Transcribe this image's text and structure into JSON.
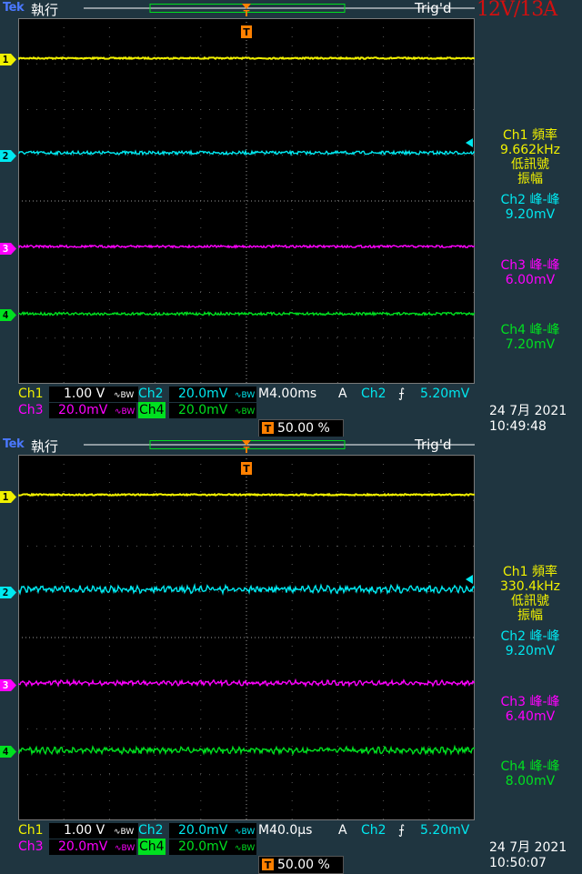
{
  "overlay_title": "12V/13A",
  "panels": [
    {
      "brand": "Tek",
      "run_state": "執行",
      "trigger_status": "Trig'd",
      "channel_markers": [
        "1",
        "2",
        "3",
        "4"
      ],
      "measurements": [
        {
          "line1": "Ch1 頻率",
          "line2": "9.662kHz",
          "line3": "低訊號",
          "line4": "振幅"
        },
        {
          "line1": "Ch2 峰-峰",
          "line2": "9.20mV"
        },
        {
          "line1": "Ch3 峰-峰",
          "line2": "6.00mV"
        },
        {
          "line1": "Ch4 峰-峰",
          "line2": "7.20mV"
        }
      ],
      "settings": {
        "ch1_label": "Ch1",
        "ch1_scale": "1.00 V",
        "ch2_label": "Ch2",
        "ch2_scale": "20.0mV",
        "ch3_label": "Ch3",
        "ch3_scale": "20.0mV",
        "ch4_label": "Ch4",
        "ch4_scale": "20.0mV",
        "bw_symbol": "∿BW",
        "timebase": "M4.00ms",
        "trigger_mode": "A",
        "trigger_source": "Ch2",
        "trigger_slope": "⨍",
        "trigger_level": "5.20mV",
        "trigger_position": "50.00 %"
      },
      "date": "24 7月  2021",
      "time": "10:49:48",
      "noise_levels": {
        "ch1": 0.15,
        "ch2": 0.35,
        "ch3": 0.25,
        "ch4": 0.3
      }
    },
    {
      "brand": "Tek",
      "run_state": "執行",
      "trigger_status": "Trig'd",
      "channel_markers": [
        "1",
        "2",
        "3",
        "4"
      ],
      "measurements": [
        {
          "line1": "Ch1 頻率",
          "line2": "330.4kHz",
          "line3": "低訊號",
          "line4": "振幅"
        },
        {
          "line1": "Ch2 峰-峰",
          "line2": "9.20mV"
        },
        {
          "line1": "Ch3 峰-峰",
          "line2": "6.40mV"
        },
        {
          "line1": "Ch4 峰-峰",
          "line2": "8.00mV"
        }
      ],
      "settings": {
        "ch1_label": "Ch1",
        "ch1_scale": "1.00 V",
        "ch2_label": "Ch2",
        "ch2_scale": "20.0mV",
        "ch3_label": "Ch3",
        "ch3_scale": "20.0mV",
        "ch4_label": "Ch4",
        "ch4_scale": "20.0mV",
        "bw_symbol": "∿BW",
        "timebase": "M40.0µs",
        "trigger_mode": "A",
        "trigger_source": "Ch2",
        "trigger_slope": "⨍",
        "trigger_level": "5.20mV",
        "trigger_position": "50.00 %"
      },
      "date": "24 7月  2021",
      "time": "10:50:07",
      "noise_levels": {
        "ch1": 0.15,
        "ch2": 0.5,
        "ch3": 0.35,
        "ch4": 0.45
      }
    }
  ],
  "colors": {
    "ch1": "#f0f000",
    "ch2": "#00e8f0",
    "ch3": "#ff00ff",
    "ch4": "#00e020",
    "background": "#1f3540",
    "screen": "#000000",
    "trigger_marker": "#ff8000",
    "title": "#d01010"
  }
}
